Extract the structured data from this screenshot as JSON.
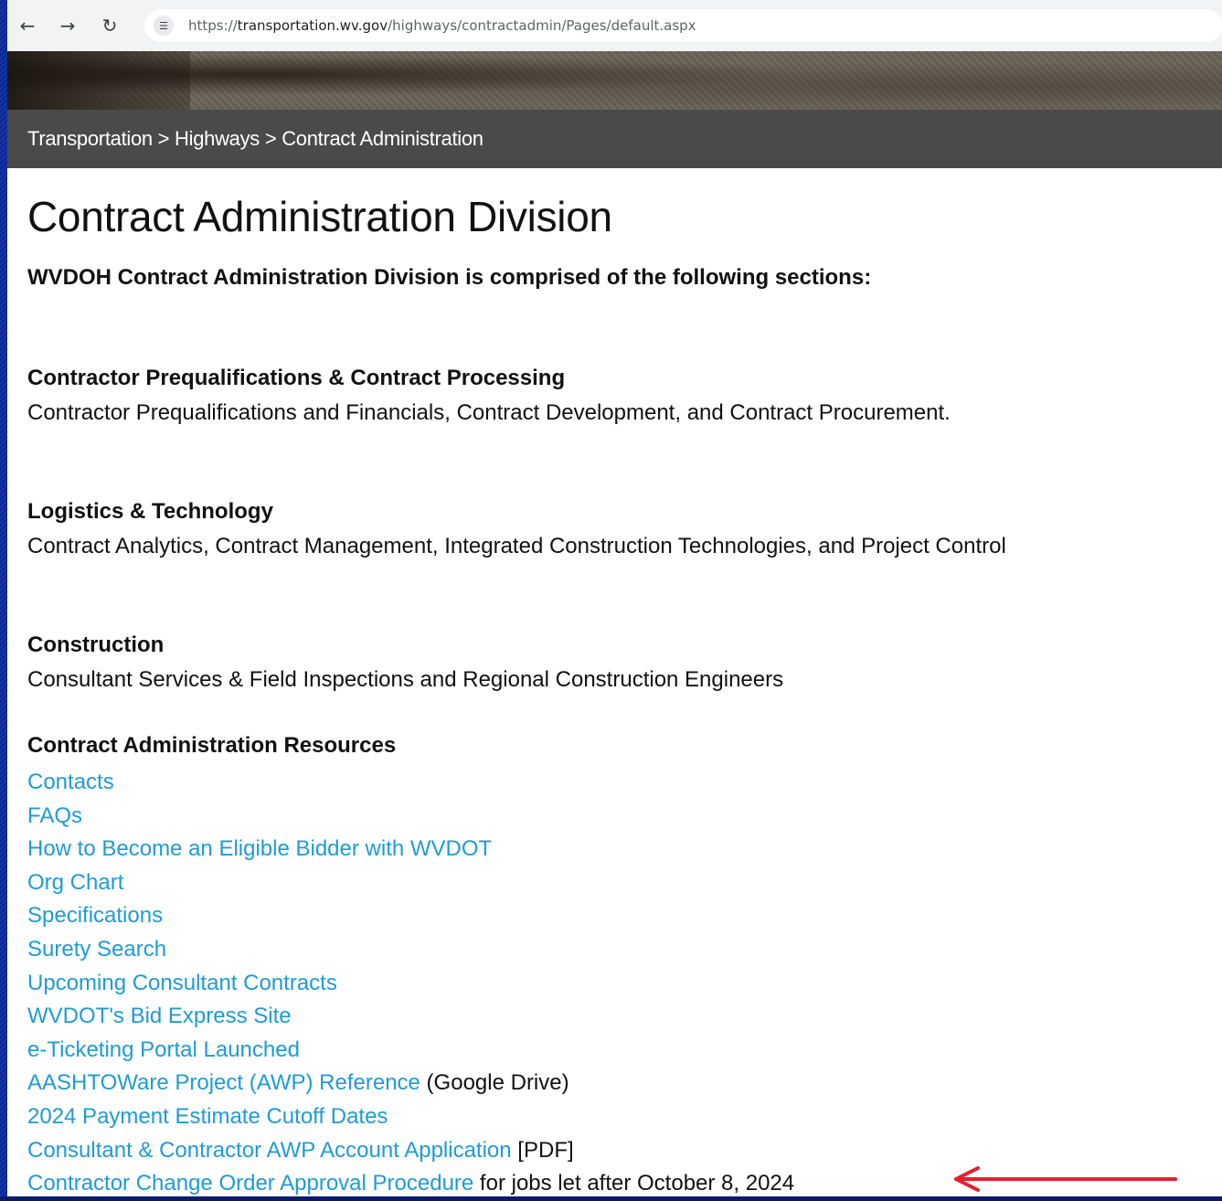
{
  "browser": {
    "url_prefix": "https://",
    "url_host": "transportation.wv.gov",
    "url_path": "/highways/contractadmin/Pages/default.aspx",
    "back_icon": "arrow-left-icon",
    "forward_icon": "arrow-right-icon",
    "reload_icon": "reload-icon",
    "site_info_icon": "tune-icon"
  },
  "breadcrumb": {
    "items": [
      "Transportation",
      "Highways",
      "Contract Administration"
    ],
    "separator": " > "
  },
  "page": {
    "title": "Contract Administration Division",
    "intro": "WVDOH Contract Administration Division is comprised of the following sections:"
  },
  "sections": [
    {
      "heading": "Contractor Prequalifications & Contract Processing",
      "description": "Contractor Prequalifications and Financials, Contract Development, and Contract Procurement."
    },
    {
      "heading": "Logistics & Technology",
      "description": "Contract Analytics, Contract Management, Integrated Construction Technologies, and Project Control"
    },
    {
      "heading": "Construction",
      "description": "Consultant Services & Field Inspections and Regional Construction Engineers"
    }
  ],
  "resources": {
    "heading": "Contract Administration Resources",
    "links": [
      {
        "label": "Contacts",
        "suffix": ""
      },
      {
        "label": "FAQs",
        "suffix": ""
      },
      {
        "label": "How to Become an Eligible Bidder with WVDOT",
        "suffix": ""
      },
      {
        "label": "Org Chart",
        "suffix": ""
      },
      {
        "label": "Specifications",
        "suffix": ""
      },
      {
        "label": "Surety Search",
        "suffix": ""
      },
      {
        "label": "Upcoming Consultant Contracts",
        "suffix": ""
      },
      {
        "label": "WVDOT's Bid Express Site",
        "suffix": ""
      },
      {
        "label": "e-Ticketing Portal Launched",
        "suffix": ""
      },
      {
        "label": "AASHTOWare Project (AWP) Reference",
        "suffix": " (Google Drive)"
      },
      {
        "label": "2024 Payment Estimate Cutoff Dates",
        "suffix": ""
      },
      {
        "label": "Consultant & Contractor AWP Account Application",
        "suffix": " [PDF]"
      },
      {
        "label": "Contractor Change Order Approval Procedure",
        "suffix": " for jobs let after October 8, 2024"
      }
    ]
  },
  "annotation": {
    "arrow_icon": "red-arrow-left-icon",
    "color": "#e0212e"
  },
  "colors": {
    "link": "#1e9bd7",
    "breadcrumb_bar": "#4a4a4a",
    "desktop": "#1536a8"
  }
}
